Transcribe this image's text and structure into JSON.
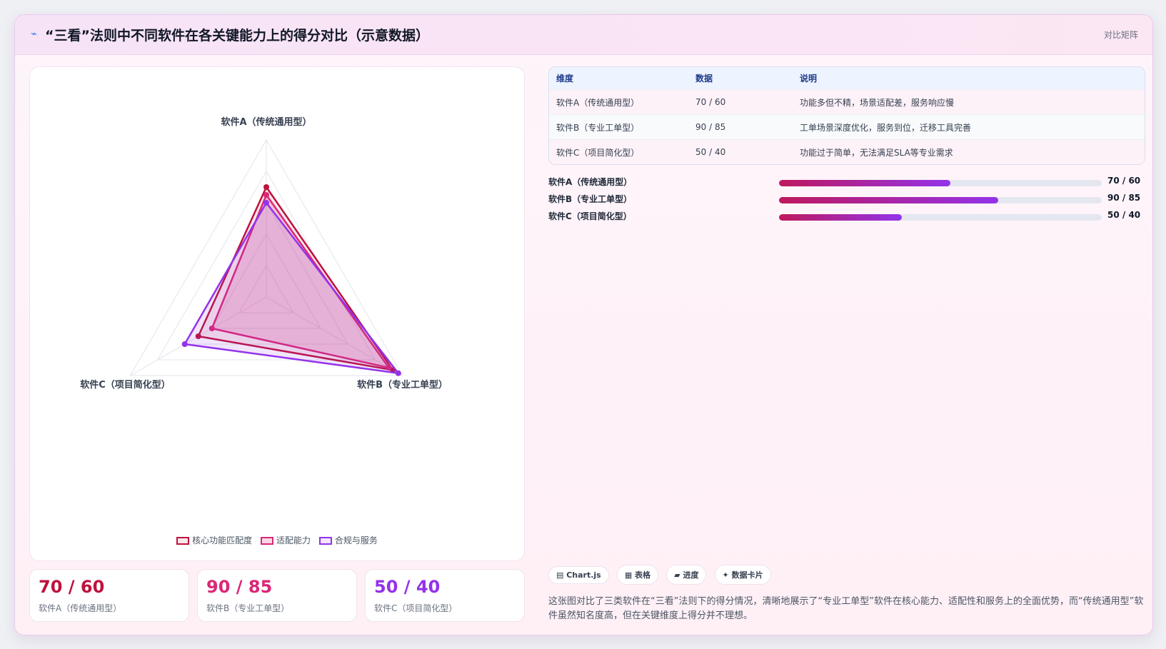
{
  "header": {
    "icon": "sparkle-icon",
    "title": "“三看”法则中不同软件在各关键能力上的得分对比（示意数据）",
    "tag": "对比矩阵"
  },
  "chart_data": {
    "type": "radar",
    "axes": [
      "软件A（传统通用型）",
      "软件B（专业工单型）",
      "软件C（项目简化型）"
    ],
    "range": [
      0,
      100
    ],
    "grid_levels": 5,
    "series": [
      {
        "name": "核心功能匹配度",
        "values": [
          70,
          93,
          50
        ],
        "color": "#be123c",
        "fill": "rgba(190,18,60,0.10)"
      },
      {
        "name": "适配能力",
        "values": [
          65,
          90,
          40
        ],
        "color": "#db2777",
        "fill": "rgba(219,39,119,0.18)"
      },
      {
        "name": "合规与服务",
        "values": [
          60,
          97,
          60
        ],
        "color": "#9333ea",
        "fill": "rgba(147,51,234,0.13)"
      }
    ]
  },
  "kpis": [
    {
      "value": "70 / 60",
      "label": "软件A（传统通用型）",
      "color": "#be123c"
    },
    {
      "value": "90 / 85",
      "label": "软件B（专业工单型）",
      "color": "#db2777"
    },
    {
      "value": "50 / 40",
      "label": "软件C（项目简化型）",
      "color": "#9333ea"
    }
  ],
  "table": {
    "headers": [
      "维度",
      "数据",
      "说明"
    ],
    "rows": [
      [
        "软件A（传统通用型）",
        "70 / 60",
        "功能多但不精，场景适配差，服务响应慢"
      ],
      [
        "软件B（专业工单型）",
        "90 / 85",
        "工单场景深度优化，服务到位，迁移工具完善"
      ],
      [
        "软件C（项目简化型）",
        "50 / 40",
        "功能过于简单，无法满足SLA等专业需求"
      ]
    ]
  },
  "bars": [
    {
      "label": "软件A（传统通用型）",
      "value": "70 / 60",
      "fraction": 0.53
    },
    {
      "label": "软件B（专业工单型）",
      "value": "90 / 85",
      "fraction": 0.68
    },
    {
      "label": "软件C（项目简化型）",
      "value": "50 / 40",
      "fraction": 0.38
    }
  ],
  "chips": [
    "▤ Chart.js",
    "▦ 表格",
    "▰ 进度",
    "✦ 数据卡片"
  ],
  "description": "这张图对比了三类软件在“三看”法则下的得分情况，清晰地展示了“专业工单型”软件在核心能力、适配性和服务上的全面优势，而“传统通用型”软件虽然知名度高，但在关键维度上得分并不理想。"
}
